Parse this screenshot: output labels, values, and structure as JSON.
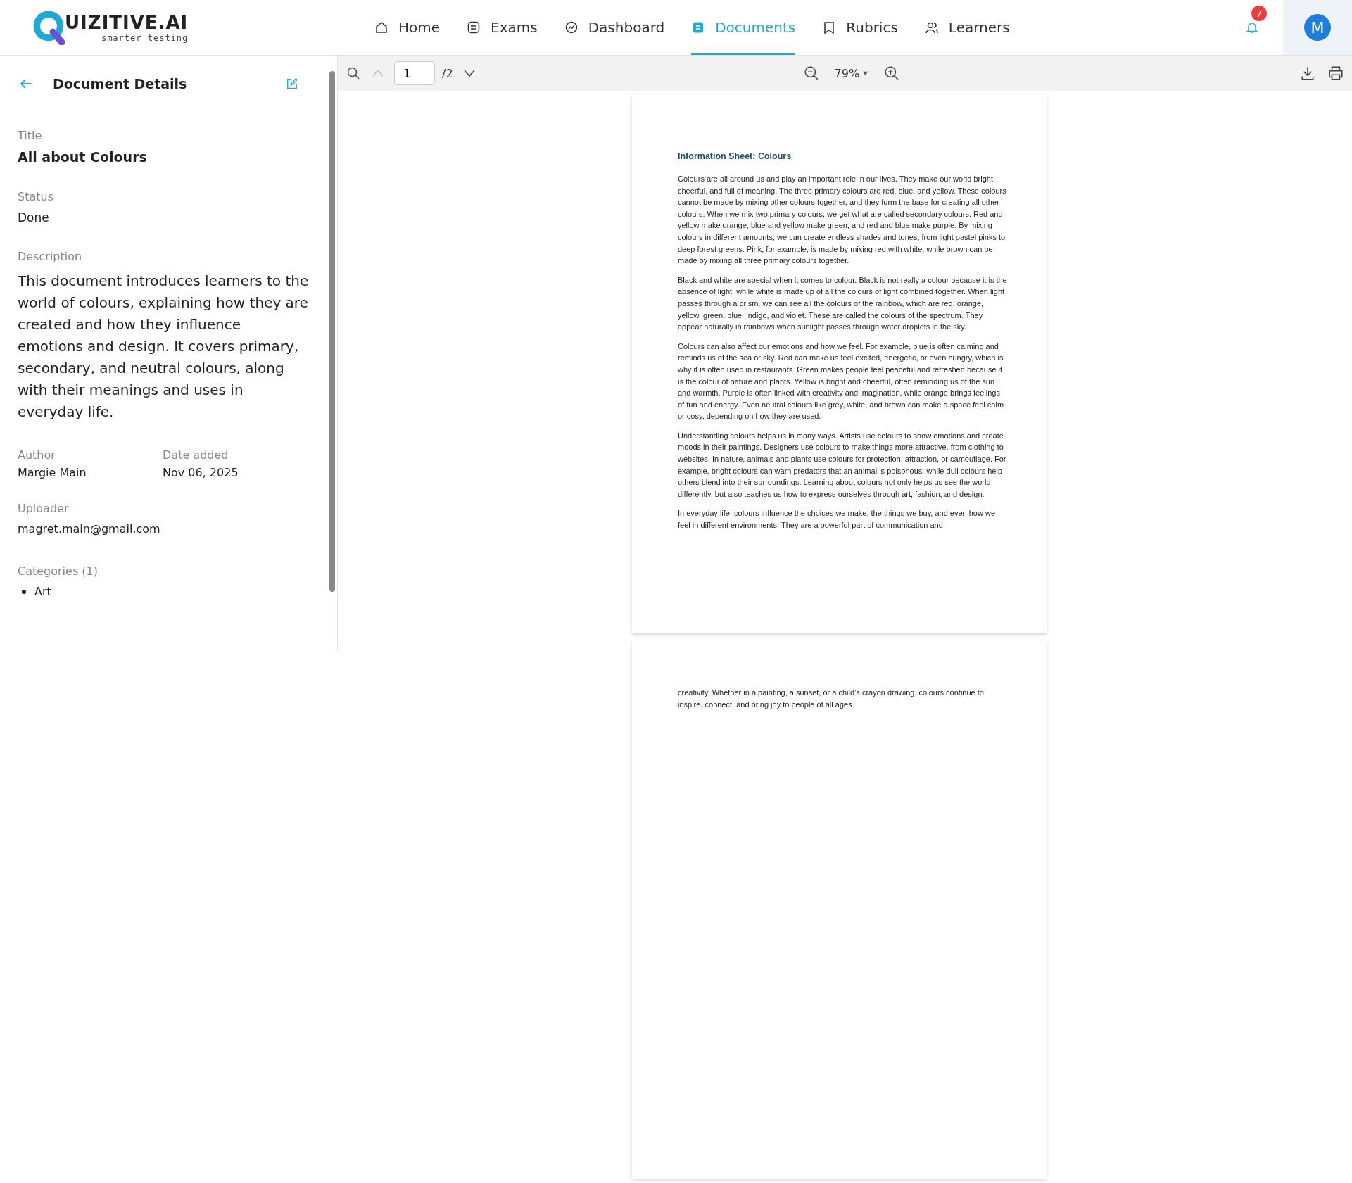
{
  "logo": {
    "name": "UIZITIVE.AI",
    "tagline": "smarter testing"
  },
  "nav": [
    {
      "label": "Home",
      "kind": "home",
      "selected": false
    },
    {
      "label": "Exams",
      "kind": "exams",
      "selected": false
    },
    {
      "label": "Dashboard",
      "kind": "dashboard",
      "selected": false
    },
    {
      "label": "Documents",
      "kind": "documents",
      "selected": true
    },
    {
      "label": "Rubrics",
      "kind": "rubrics",
      "selected": false
    },
    {
      "label": "Learners",
      "kind": "learners",
      "selected": false
    }
  ],
  "notifications": {
    "count": "7"
  },
  "avatar": {
    "initial": "M"
  },
  "details": {
    "heading": "Document Details",
    "fields": [
      {
        "label": "Title",
        "value": "All about Colours",
        "kind": "title"
      },
      {
        "label": "Status",
        "value": "Done",
        "kind": "plain"
      },
      {
        "label": "Description",
        "value": "This document introduces learners to the world of colours, explaining how they are created and how they influence emotions and design. It covers primary, secondary, and neutral colours, along with their meanings and uses in everyday life.",
        "kind": "description"
      }
    ],
    "pair": [
      {
        "label": "Author",
        "value": "Margie Main"
      },
      {
        "label": "Date added",
        "value": "Nov 06, 2025"
      }
    ],
    "uploader": {
      "label": "Uploader",
      "value": "magret.main@gmail.com"
    },
    "categories": {
      "label": "Categories (1)",
      "items": [
        "Art"
      ]
    }
  },
  "viewer": {
    "page": "1",
    "page_count": "/2",
    "zoom": "79%",
    "pages": [
      {
        "heading": "Information Sheet: Colours",
        "paragraphs": [
          "Colours are all around us and play an important role in our lives. They make our world bright, cheerful, and full of meaning. The three primary colours are red, blue, and yellow. These colours cannot be made by mixing other colours together, and they form the base for creating all other colours. When we mix two primary colours, we get what are called secondary colours. Red and yellow make orange, blue and yellow make green, and red and blue make purple. By mixing colours in different amounts, we can create endless shades and tones, from light pastel pinks to deep forest greens. Pink, for example, is made by mixing red with white, while brown can be made by mixing all three primary colours together.",
          "Black and white are special when it comes to colour. Black is not really a colour because it is the absence of light, while white is made up of all the colours of light combined together. When light passes through a prism, we can see all the colours of the rainbow, which are red, orange, yellow, green, blue, indigo, and violet. These are called the colours of the spectrum. They appear naturally in rainbows when sunlight passes through water droplets in the sky.",
          "Colours can also affect our emotions and how we feel. For example, blue is often calming and reminds us of the sea or sky. Red can make us feel excited, energetic, or even hungry, which is why it is often used in restaurants. Green makes people feel peaceful and refreshed because it is the colour of nature and plants. Yellow is bright and cheerful, often reminding us of the sun and warmth. Purple is often linked with creativity and imagination, while orange brings feelings of fun and energy. Even neutral colours like grey, white, and brown can make a space feel calm or cosy, depending on how they are used.",
          "Understanding colours helps us in many ways. Artists use colours to show emotions and create moods in their paintings. Designers use colours to make things more attractive, from clothing to websites. In nature, animals and plants use colours for protection, attraction, or camouflage. For example, bright colours can warn predators that an animal is poisonous, while dull colours help others blend into their surroundings. Learning about colours not only helps us see the world differently, but also teaches us how to express ourselves through art, fashion, and design.",
          "In everyday life, colours influence the choices we make, the things we buy, and even how we feel in different environments. They are a powerful part of communication and"
        ]
      },
      {
        "paragraphs": [
          "creativity. Whether in a painting, a sunset, or a child’s crayon drawing, colours continue to inspire, connect, and bring joy to people of all ages."
        ]
      }
    ]
  }
}
